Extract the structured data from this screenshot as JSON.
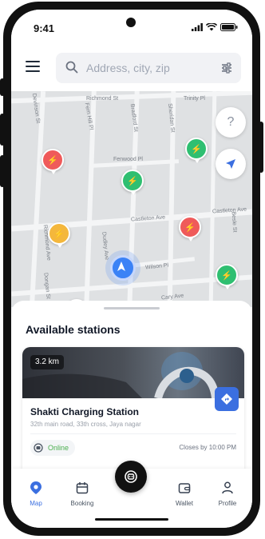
{
  "status_bar": {
    "time": "9:41"
  },
  "header": {
    "menu_icon": "hamburger-menu-icon",
    "search": {
      "placeholder": "Address, city, zip",
      "value": "",
      "icon": "search-icon"
    },
    "filter_icon": "filter-sliders-icon"
  },
  "map": {
    "street_labels": [
      "Richmond St",
      "Trinity Pl",
      "Fern Hill Pl",
      "Bradford St",
      "Sheridan St",
      "Devinson St",
      "Fenwood Pl",
      "Castleton Ave",
      "Castleton Ave",
      "Besle St",
      "Wilson Pl",
      "Dongan St",
      "Cary Ave",
      "Richmond Ave",
      "Dudley Ave"
    ],
    "help_label": "?",
    "pins": [
      {
        "color": "red",
        "icon": "bolt-icon"
      },
      {
        "color": "green",
        "icon": "bolt-icon"
      },
      {
        "color": "green",
        "icon": "bolt-icon"
      },
      {
        "color": "red",
        "icon": "bolt-icon"
      },
      {
        "color": "yellow",
        "icon": "bolt-icon"
      },
      {
        "color": "green",
        "icon": "bolt-icon"
      },
      {
        "color": "green",
        "icon": "bolt-icon"
      }
    ]
  },
  "sheet": {
    "title": "Available stations",
    "station": {
      "distance": "3.2 km",
      "name": "Shakti Charging Station",
      "address": "32th main road, 33th cross, Jaya nagar",
      "status": "Online",
      "closes": "Closes by 10:00 PM"
    }
  },
  "tabs": [
    {
      "label": "Map",
      "icon": "location-pin-icon",
      "active": true
    },
    {
      "label": "Booking",
      "icon": "calendar-icon",
      "active": false
    },
    {
      "label": "Wallet",
      "icon": "wallet-icon",
      "active": false
    },
    {
      "label": "Profile",
      "icon": "person-icon",
      "active": false
    }
  ],
  "colors": {
    "accent": "#3b6fe0",
    "online": "#4caf50",
    "pin_red": "#ef5a5a",
    "pin_green": "#2fbf71",
    "pin_yellow": "#f4b73c"
  }
}
